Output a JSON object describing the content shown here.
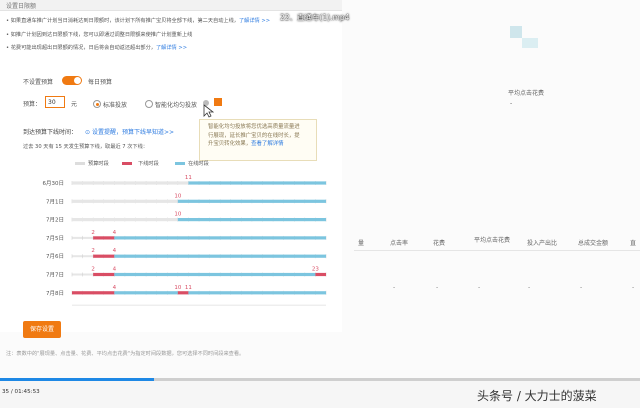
{
  "video": {
    "title": "22、直通车(1).mp4",
    "time": "35 / 01:45:53",
    "progress_fraction": 0.24,
    "watermark": "头条号 / 大力士的菠菜"
  },
  "header": {
    "title": "设置日限额"
  },
  "notes": [
    {
      "text": "如果直通车推广计划当日消耗达到日限额时，该计划下所有推广宝贝将全部下线，第二天自动上线，",
      "link": "了解详情 >>"
    },
    {
      "text": "如推广计划因到达日限额下线，您可以即通过调整日限额来使推广计划重新上线",
      "link": ""
    },
    {
      "text": "花费可能出现超出日限额的情况，日后将会自动返还超出部分，",
      "link": "了解详情 >>"
    }
  ],
  "budget_row": {
    "no_limit_label": "不设置预算",
    "daily_label": "每日预算",
    "budget_label": "预算：",
    "budget_value": "30",
    "unit": "元",
    "std_label": "标准投放",
    "smart_label": "智能化均匀投放",
    "std_selected": true
  },
  "tooltip": {
    "lines": [
      "智能化均匀投放将您优选高质量流量进",
      "行展现，延长推广宝贝的在线时长，提",
      "升宝贝转化效果，"
    ],
    "link": "查看了解详情"
  },
  "offline": {
    "label": "到达预算下线时间：",
    "remind": "设置提醒",
    "link": "预算下线早知道>>",
    "summary": "过去 30 天有 15 天发生预算下线，取最近 7 次下线："
  },
  "right_panel": {
    "avg_cost_label": "平均点击花费",
    "dash": "-"
  },
  "table": {
    "headers": [
      "量",
      "点击率",
      "花费",
      "平均点击花费",
      "投入产出比",
      "总成交金额",
      "直"
    ],
    "dash": "-"
  },
  "save_button": "保存设置",
  "footer_note": "注：表数中的\"展现量、点击量、花费、平均点击花费\"为指定时间段数据，您可选择不同时间段来查看。",
  "colors": {
    "accent": "#f07a12",
    "link": "#2d7be0",
    "online": "#7cc5df",
    "offline": "#d94d64"
  },
  "chart_data": {
    "type": "timeline",
    "legend": [
      "预算时段",
      "下线时段",
      "在线时段"
    ],
    "x_ticks": [
      "0",
      "3",
      "6",
      "9",
      "12",
      "15",
      "18",
      "21",
      "24"
    ],
    "xlim": [
      0,
      24
    ],
    "rows": [
      {
        "day": "6月30日",
        "offline_start": 0,
        "online_start": 11,
        "labels": [
          "11"
        ]
      },
      {
        "day": "7月1日",
        "offline_start": 0,
        "online_start": 10,
        "labels": [
          "10"
        ]
      },
      {
        "day": "7月2日",
        "offline_start": 0,
        "online_start": 10,
        "labels": [
          "10"
        ]
      },
      {
        "day": "7月5日",
        "offline_start": 2,
        "online_start": 4,
        "labels": [
          "2",
          "4"
        ]
      },
      {
        "day": "7月6日",
        "offline_start": 2,
        "online_start": 4,
        "labels": [
          "2",
          "4"
        ]
      },
      {
        "day": "7月7日",
        "offline_start": 2,
        "online_start": 4,
        "labels": [
          "2",
          "4",
          "23"
        ],
        "offline2_start": 23
      },
      {
        "day": "7月8日",
        "offline_start": 0,
        "online_start": 4,
        "labels": [
          "4",
          "10",
          "11"
        ],
        "offline2_start": 10,
        "offline2_end": 11
      }
    ]
  }
}
